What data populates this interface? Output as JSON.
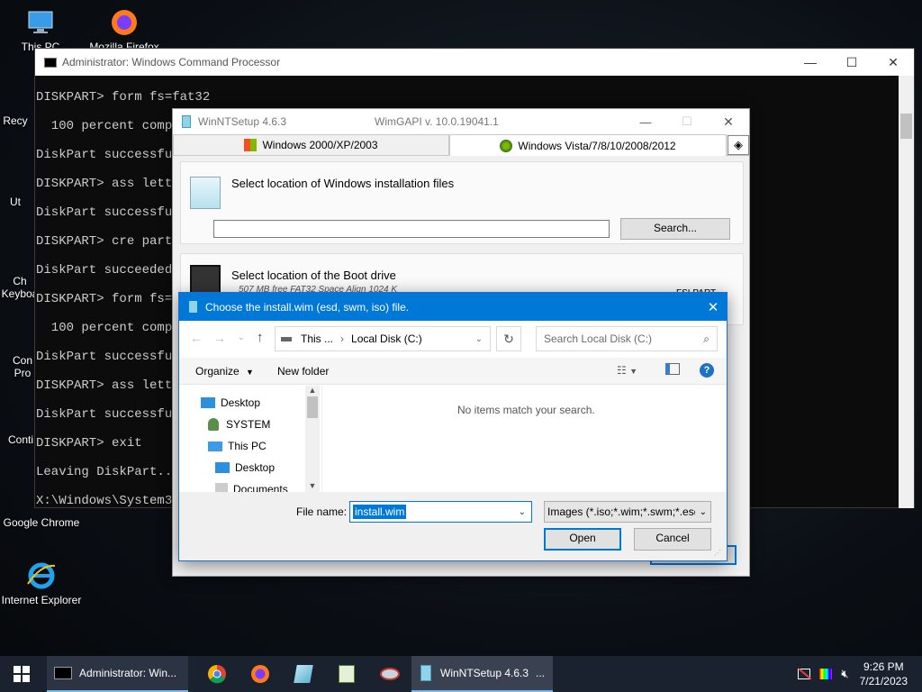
{
  "desktop": {
    "icons": [
      {
        "label": "This PC"
      },
      {
        "label": "Mozilla Firefox"
      },
      {
        "label": "Recy"
      },
      {
        "label": "Ut"
      },
      {
        "label": "Ch Keyboa"
      },
      {
        "label": "Con Pro"
      },
      {
        "label": "Conti"
      },
      {
        "label": "Google Chrome"
      },
      {
        "label": "Internet Explorer"
      }
    ]
  },
  "cmd": {
    "title": "Administrator: Windows Command Processor",
    "lines": [
      "DISKPART> form fs=fat32",
      "  100 percent compl",
      "DiskPart successful",
      "DISKPART> ass lette",
      "DiskPart successful",
      "DISKPART> cre part",
      "DiskPart succeeded",
      "DISKPART> form fs=n",
      "  100 percent compl",
      "DiskPart successful",
      "DISKPART> ass lette",
      "DiskPart successful",
      "DISKPART> exit",
      "Leaving DiskPart...",
      "X:\\Windows\\System32"
    ],
    "controls": {
      "minimize": "—",
      "maximize": "☐",
      "close": "✕"
    }
  },
  "winntsetup": {
    "title": "WinNTSetup 4.6.3",
    "wimgapi": "WimGAPI v. 10.0.19041.1",
    "tabs": [
      {
        "label": "Windows 2000/XP/2003"
      },
      {
        "label": "Windows Vista/7/8/10/2008/2012"
      }
    ],
    "install_section": {
      "heading": "Select location of Windows installation files",
      "path_value": "",
      "search_button": "Search..."
    },
    "boot_section": {
      "heading": "Select location of the Boot drive",
      "detail": "507 MB free FAT32 Space Align 1024 K",
      "status": "FSLPART"
    }
  },
  "dialog": {
    "title": "Choose the install.wim (esd, swm, iso) file.",
    "breadcrumb": [
      "This ...",
      "Local Disk (C:)"
    ],
    "search_placeholder": "Search Local Disk (C:)",
    "toolbar": {
      "organize": "Organize",
      "new_folder": "New folder"
    },
    "nav_items": [
      {
        "label": "Desktop"
      },
      {
        "label": "SYSTEM"
      },
      {
        "label": "This PC"
      },
      {
        "label": "Desktop"
      },
      {
        "label": "Documents"
      }
    ],
    "empty_message": "No items match your search.",
    "file_name_label": "File name:",
    "file_name_value": "install.wim",
    "filter_value": "Images (*.iso;*.wim;*.swm;*.esd",
    "open_button": "Open",
    "cancel_button": "Cancel"
  },
  "taskbar": {
    "cmd_app": "Administrator: Win...",
    "wnt_app": "WinNTSetup 4.6.3",
    "wnt_more": "...",
    "time": "9:26 PM",
    "date": "7/21/2023"
  },
  "colors": {
    "accent": "#0078d7",
    "taskbar": "#1a2230"
  }
}
